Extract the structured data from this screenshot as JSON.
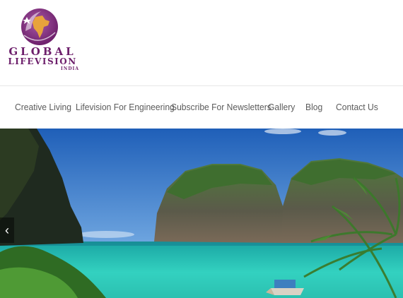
{
  "brand": {
    "line1": "GLOBAL",
    "line2": "LIFEVISION",
    "line3": "INDIA",
    "logo_icon": "india-map-globe-icon",
    "brand_color": "#6d1f6b"
  },
  "nav": {
    "items": [
      {
        "label": "Creative Living"
      },
      {
        "label": "Lifevision For Engineering"
      },
      {
        "label": "Subscribe For Newsletters"
      },
      {
        "label": "Gallery"
      },
      {
        "label": "Blog"
      },
      {
        "label": "Contact Us"
      }
    ],
    "text_color": "#5b5b5b"
  },
  "slider": {
    "image": "tropical-bay-with-limestone-cliffs",
    "prev_icon": "chevron-left-icon",
    "prev_glyph": "‹"
  }
}
